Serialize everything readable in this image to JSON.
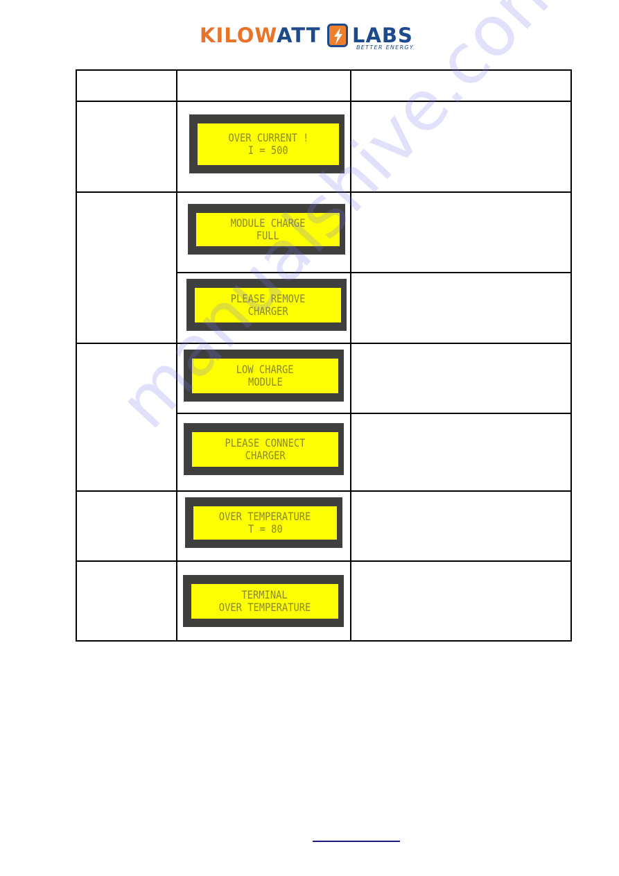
{
  "logo": {
    "brand_part1": "KILO",
    "brand_w": "W",
    "brand_part2": "ATT",
    "brand_part3": "LABS",
    "tagline": "BETTER ENERGY",
    "icon": "lightning-bolt-icon",
    "colors": {
      "orange": "#e8742c",
      "navy": "#1c4a8c"
    }
  },
  "table": {
    "header": [
      "",
      "",
      ""
    ],
    "rows": [
      {
        "label": "",
        "displays": [
          {
            "lines": [
              "OVER CURRENT !",
              "I = 500"
            ],
            "description": ""
          }
        ]
      },
      {
        "label": "",
        "displays": [
          {
            "lines": [
              "MODULE CHARGE",
              "FULL"
            ],
            "description": ""
          },
          {
            "lines": [
              "PLEASE REMOVE",
              "CHARGER"
            ],
            "description": ""
          }
        ]
      },
      {
        "label": "",
        "displays": [
          {
            "lines": [
              "LOW CHARGE",
              "MODULE"
            ],
            "description": ""
          },
          {
            "lines": [
              "PLEASE CONNECT",
              "CHARGER"
            ],
            "description": ""
          }
        ]
      },
      {
        "label": "",
        "displays": [
          {
            "lines": [
              "OVER TEMPERATURE",
              "T = 80"
            ],
            "description": ""
          }
        ]
      },
      {
        "label": "",
        "displays": [
          {
            "lines": [
              "TERMINAL",
              "OVER TEMPERATURE"
            ],
            "description": ""
          }
        ]
      }
    ],
    "lcd_colors": {
      "bezel": "#3f3f3d",
      "screen": "#fdfd04",
      "text": "#8c8a2a"
    }
  },
  "watermark": "manualshive.com",
  "footer": {
    "link_text": ""
  }
}
